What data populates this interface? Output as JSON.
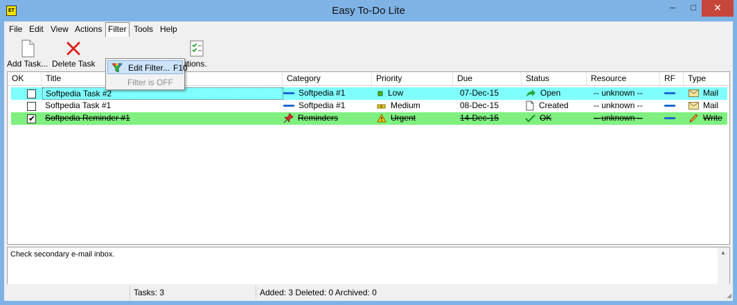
{
  "window": {
    "title": "Easy To-Do Lite",
    "icon_text": "ET",
    "min": "‒",
    "max": "□",
    "close": "✕"
  },
  "menu": [
    "File",
    "Edit",
    "View",
    "Actions",
    "Filter",
    "Tools",
    "Help"
  ],
  "toolbar": {
    "add_task": "Add Task...",
    "delete_task": "Delete Task",
    "options": "Options..."
  },
  "filter_menu": {
    "edit_filter": "Edit Filter...",
    "edit_filter_shortcut": "F10",
    "filter_status": "Filter is OFF"
  },
  "columns": [
    "OK",
    "Title",
    "Category",
    "Priority",
    "Due",
    "Status",
    "Resource",
    "RF",
    "Type"
  ],
  "tasks": [
    {
      "ok": false,
      "title": "Softpedia Task #2",
      "category": "Softpedia #1",
      "priority": "Low",
      "due": "07-Dec-15",
      "status": "Open",
      "resource": "-- unknown --",
      "type": "Mail"
    },
    {
      "ok": false,
      "title": "Softpedia Task #1",
      "category": "Softpedia #1",
      "priority": "Medium",
      "due": "08-Dec-15",
      "status": "Created",
      "resource": "-- unknown --",
      "type": "Mail"
    },
    {
      "ok": true,
      "title": "Softpedia Reminder #1",
      "category": "Reminders",
      "priority": "Urgent",
      "due": "14-Dec-15",
      "status": "OK",
      "resource": "-- unknown --",
      "type": "Write"
    }
  ],
  "notes": "Check secondary e-mail inbox.",
  "status": {
    "tasks": "Tasks: 3",
    "summary": "Added: 3 Deleted: 0 Archived: 0"
  },
  "colors": {
    "selected_row": "#80ffff",
    "completed_row": "#7fef7f",
    "accent": "#1c66d4"
  }
}
